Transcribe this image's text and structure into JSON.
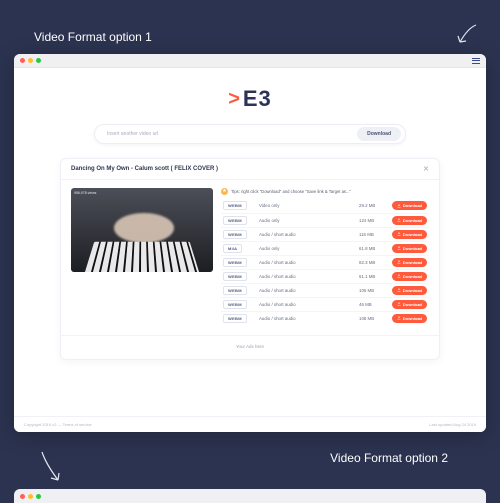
{
  "captions": {
    "opt1": "Video Format option 1",
    "opt2": "Video Format option 2"
  },
  "logo": {
    "mark": ">",
    "text": "E3"
  },
  "search": {
    "placeholder": "Insert another video url",
    "button": "Download"
  },
  "video": {
    "title": "Dancing On My Own - Calum scott ( FELIX COVER )",
    "views": "956,978 views",
    "tip": "Tips: right click \"Download\" and choose \"Save link & Target as...\""
  },
  "formats": [
    {
      "fmt": "WEBM",
      "label": "Video only",
      "size": "29.2 MB",
      "action": "Download"
    },
    {
      "fmt": "WEBM",
      "label": "Audio only",
      "size": "124 MB",
      "action": "Download"
    },
    {
      "fmt": "WEBM",
      "label": "Audio / short audio",
      "size": "116 MB",
      "action": "Download"
    },
    {
      "fmt": "M4A",
      "label": "Audio only",
      "size": "61.8 MB",
      "action": "Download"
    },
    {
      "fmt": "WEBM",
      "label": "Audio / short audio",
      "size": "82.3 MB",
      "action": "Download"
    },
    {
      "fmt": "WEBM",
      "label": "Audio / short audio",
      "size": "61.1 MB",
      "action": "Download"
    },
    {
      "fmt": "WEBM",
      "label": "Audio / short audio",
      "size": "105 MB",
      "action": "Download"
    },
    {
      "fmt": "WEBM",
      "label": "Audio / short audio",
      "size": "46 MB",
      "action": "Download"
    },
    {
      "fmt": "WEBM",
      "label": "Audio / short audio",
      "size": "108 MB",
      "action": "Download"
    }
  ],
  "ads": "Your Ads here",
  "footer": {
    "left": "Copyright 2019 c2 — Terms of service",
    "right": "Last updated Aug 24 2019"
  }
}
